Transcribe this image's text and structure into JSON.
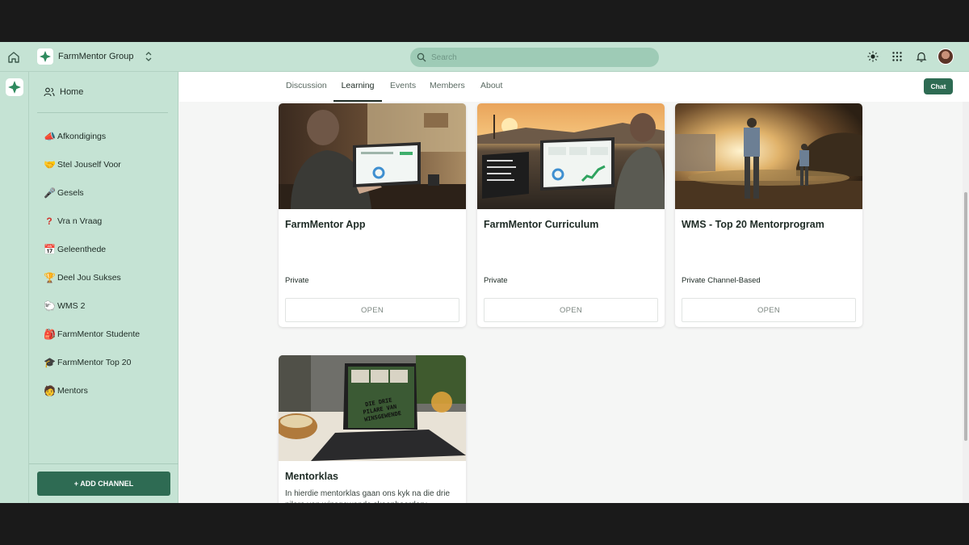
{
  "topbar": {
    "group_name": "FarmMentor Group",
    "search_placeholder": "Search",
    "icons": [
      "home-icon",
      "chevron-updown-icon",
      "search-icon",
      "sun-icon",
      "apps-grid-icon",
      "bell-icon",
      "avatar"
    ]
  },
  "sidebar": {
    "home_label": "Home",
    "channels": [
      {
        "label": "Afkondigings",
        "icon": "megaphone-icon"
      },
      {
        "label": "Stel Jouself Voor",
        "icon": "handshake-icon"
      },
      {
        "label": "Gesels",
        "icon": "microphone-icon"
      },
      {
        "label": "Vra n Vraag",
        "icon": "question-icon"
      },
      {
        "label": "Geleenthede",
        "icon": "calendar-icon"
      },
      {
        "label": "Deel Jou Sukses",
        "icon": "trophy-icon"
      },
      {
        "label": "WMS 2",
        "icon": "sheep-icon"
      },
      {
        "label": "FarmMentor Studente",
        "icon": "student-icon"
      },
      {
        "label": "FarmMentor Top 20",
        "icon": "graduate-icon"
      },
      {
        "label": "Mentors",
        "icon": "mentor-icon"
      }
    ],
    "add_channel_label": "+ ADD CHANNEL"
  },
  "tabs": {
    "items": [
      "Discussion",
      "Learning",
      "Events",
      "Members",
      "About"
    ],
    "active": "Learning",
    "chat_label": "Chat"
  },
  "courses": [
    {
      "title": "FarmMentor App",
      "privacy": "Private",
      "button": "OPEN"
    },
    {
      "title": "FarmMentor Curriculum",
      "privacy": "Private",
      "button": "OPEN"
    },
    {
      "title": "WMS - Top 20 Mentorprogram",
      "privacy": "Private Channel-Based",
      "button": "OPEN"
    },
    {
      "title": "Mentorklas",
      "description": "In hierdie mentorklas gaan ons kyk na die drie pilare van winsgewende skaapboerdery"
    }
  ],
  "laptop_text": "DIE DRIE PILARE VAN WINSGEWENDE",
  "colors": {
    "accent": "#2e6b53",
    "sidebar": "#c5e3d4",
    "search": "#9ecbb6"
  }
}
